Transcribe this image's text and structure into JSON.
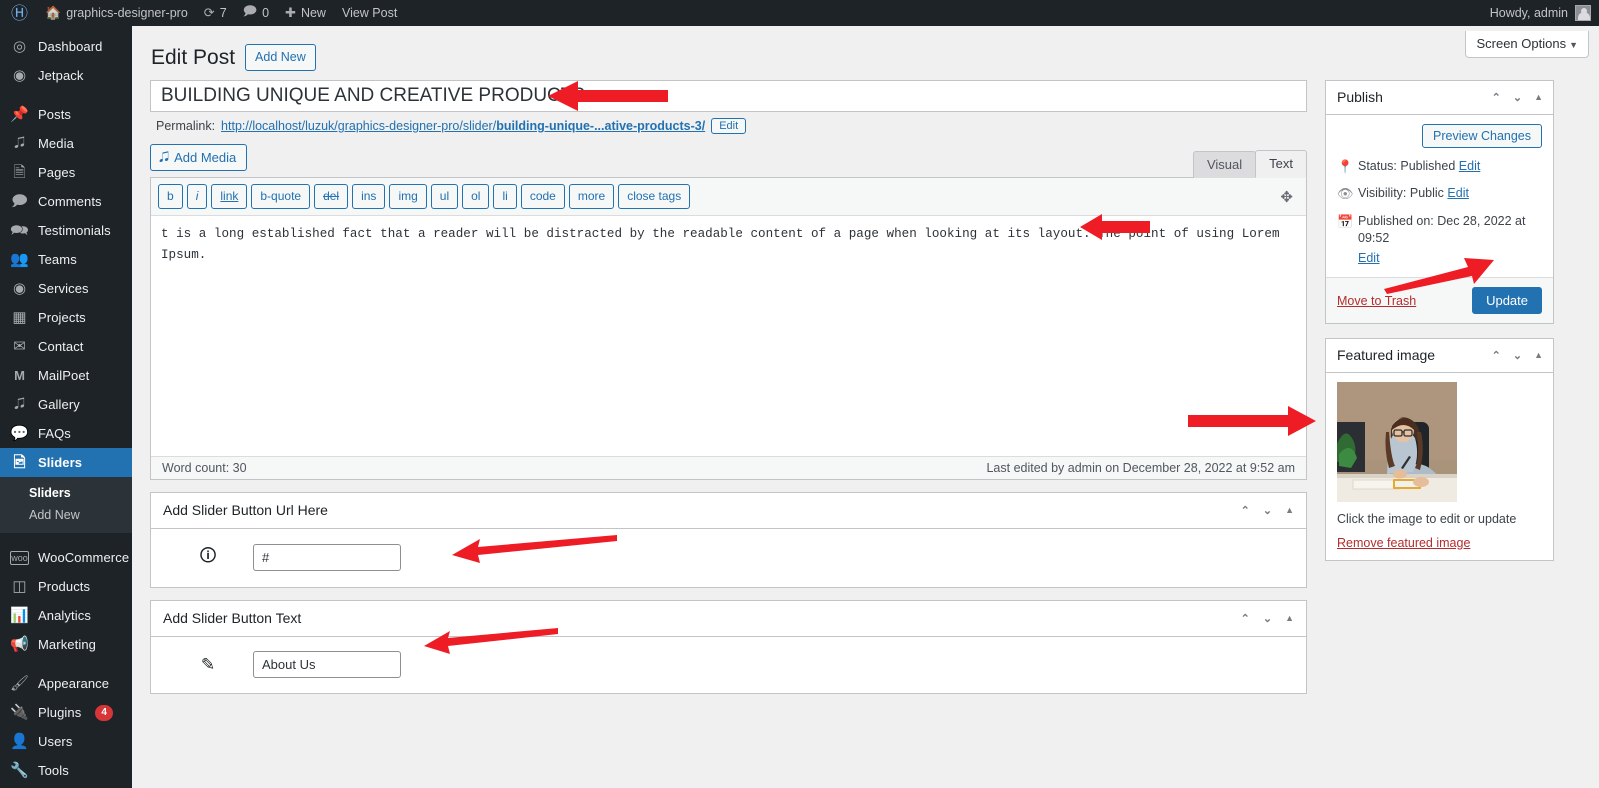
{
  "adminbar": {
    "logo_icon": "wordpress-logo-icon",
    "site_name": "graphics-designer-pro",
    "updates_count": "7",
    "comments_count": "0",
    "new_label": "New",
    "view_post_label": "View Post",
    "howdy": "Howdy, admin"
  },
  "sidebar": {
    "items": [
      {
        "label": "Dashboard",
        "icon": "dashboard-icon"
      },
      {
        "label": "Jetpack",
        "icon": "jetpack-icon"
      },
      {
        "label": "Posts",
        "icon": "pin-icon"
      },
      {
        "label": "Media",
        "icon": "media-icon"
      },
      {
        "label": "Pages",
        "icon": "pages-icon"
      },
      {
        "label": "Comments",
        "icon": "comment-icon"
      },
      {
        "label": "Testimonials",
        "icon": "testimonials-icon"
      },
      {
        "label": "Teams",
        "icon": "teams-icon"
      },
      {
        "label": "Services",
        "icon": "services-eye-icon"
      },
      {
        "label": "Projects",
        "icon": "projects-icon"
      },
      {
        "label": "Contact",
        "icon": "envelope-icon"
      },
      {
        "label": "MailPoet",
        "icon": "mailpoet-icon"
      },
      {
        "label": "Gallery",
        "icon": "gallery-icon"
      },
      {
        "label": "FAQs",
        "icon": "faq-icon"
      },
      {
        "label": "Sliders",
        "icon": "sliders-icon",
        "current": true
      },
      {
        "label": "WooCommerce",
        "icon": "woocommerce-icon"
      },
      {
        "label": "Products",
        "icon": "products-icon"
      },
      {
        "label": "Analytics",
        "icon": "analytics-icon"
      },
      {
        "label": "Marketing",
        "icon": "marketing-megaphone-icon"
      },
      {
        "label": "Appearance",
        "icon": "appearance-brush-icon"
      },
      {
        "label": "Plugins",
        "icon": "plugins-plug-icon",
        "badge": "4"
      },
      {
        "label": "Users",
        "icon": "users-icon"
      },
      {
        "label": "Tools",
        "icon": "tools-wrench-icon"
      }
    ],
    "submenu": {
      "items": [
        "Sliders",
        "Add New"
      ],
      "current": "Sliders"
    }
  },
  "screen_options": {
    "label": "Screen Options"
  },
  "header": {
    "page_title": "Edit Post",
    "add_new_label": "Add New"
  },
  "post": {
    "title": "BUILDING UNIQUE AND CREATIVE PRODUCTS",
    "permalink_label": "Permalink:",
    "permalink_prefix": "http://localhost/luzuk/graphics-designer-pro/slider/",
    "permalink_slug": "building-unique-...ative-products-3/",
    "permalink_edit_label": "Edit",
    "add_media_label": "Add Media",
    "tabs": {
      "visual": "Visual",
      "text": "Text",
      "active": "Text"
    },
    "quicktags": [
      "b",
      "i",
      "link",
      "b-quote",
      "del",
      "ins",
      "img",
      "ul",
      "ol",
      "li",
      "code",
      "more",
      "close tags"
    ],
    "content": "t is a long established fact that a reader will be distracted by the readable content of a page when looking at its layout. The point of using Lorem Ipsum.",
    "word_count_label": "Word count: 30",
    "last_edited": "Last edited by admin on December 28, 2022 at 9:52 am"
  },
  "metaboxes": [
    {
      "title": "Add Slider Button Url Here",
      "icon": "info-icon",
      "field_name": "slider-button-url-input",
      "value": "#"
    },
    {
      "title": "Add Slider Button Text",
      "icon": "pencil-icon",
      "field_name": "slider-button-text-input",
      "value": "About Us"
    }
  ],
  "publish": {
    "title": "Publish",
    "preview_label": "Preview Changes",
    "status_label": "Status: Published",
    "status_edit": "Edit",
    "visibility_label": "Visibility: Public",
    "visibility_edit": "Edit",
    "published_label": "Published on: Dec 28, 2022 at 09:52",
    "published_edit": "Edit",
    "trash_label": "Move to Trash",
    "update_label": "Update"
  },
  "featured_image": {
    "title": "Featured image",
    "caption": "Click the image to edit or update",
    "remove_label": "Remove featured image",
    "alt": "woman-writing-at-desk-photo"
  },
  "colors": {
    "admin_bar": "#1d2327",
    "sidebar": "#1d2327",
    "accent_blue": "#2271b1",
    "submenu_bg": "#2c3338",
    "body_bg": "#f0f0f1",
    "arrow_red": "#ee1c25",
    "trash_red": "#b32d2e"
  }
}
